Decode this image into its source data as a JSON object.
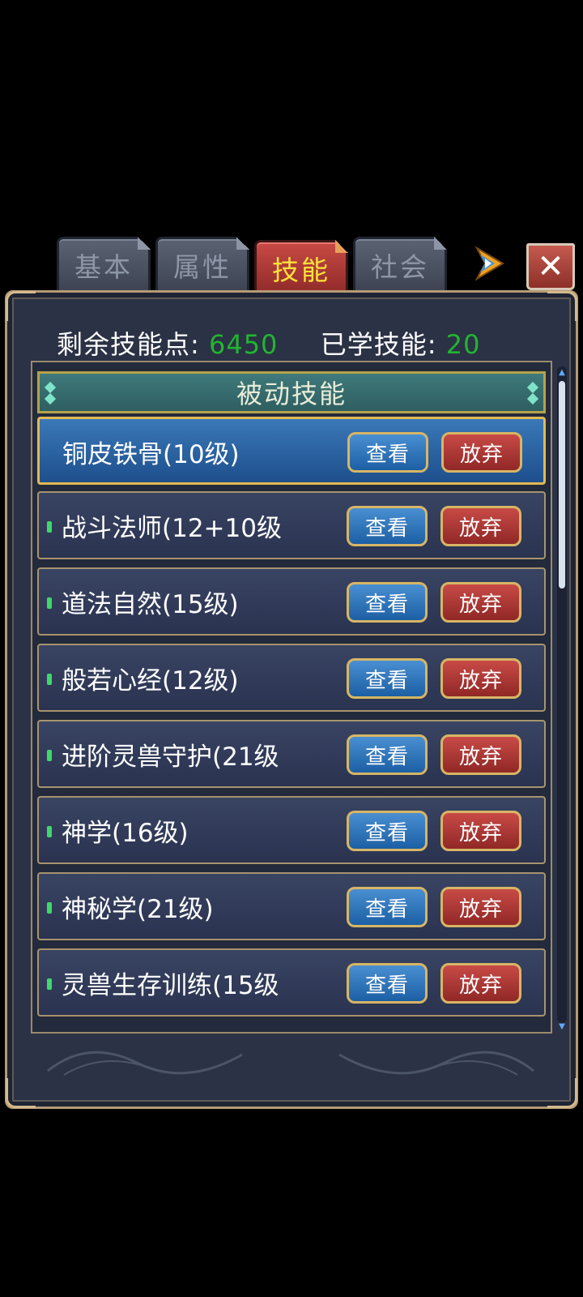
{
  "tabs": [
    {
      "label": "基本",
      "active": false
    },
    {
      "label": "属性",
      "active": false
    },
    {
      "label": "技能",
      "active": true
    },
    {
      "label": "社会",
      "active": false
    }
  ],
  "close_label": "✕",
  "stats": {
    "points_label": "剩余技能点:",
    "points_value": "6450",
    "learned_label": "已学技能:",
    "learned_value": "20"
  },
  "section_title": "被动技能",
  "skills": [
    {
      "name": "铜皮铁骨(10级)",
      "selected": true
    },
    {
      "name": "战斗法师(12+10级",
      "selected": false
    },
    {
      "name": "道法自然(15级)",
      "selected": false
    },
    {
      "name": "般若心经(12级)",
      "selected": false
    },
    {
      "name": "进阶灵兽守护(21级",
      "selected": false
    },
    {
      "name": "神学(16级)",
      "selected": false
    },
    {
      "name": "神秘学(21级)",
      "selected": false
    },
    {
      "name": "灵兽生存训练(15级",
      "selected": false
    }
  ],
  "buttons": {
    "view_label": "查看",
    "drop_label": "放弃"
  },
  "colors": {
    "highlight_number": "#22b530",
    "active_tab_text": "#ffe23a",
    "panel_bg": "#2b3245"
  }
}
